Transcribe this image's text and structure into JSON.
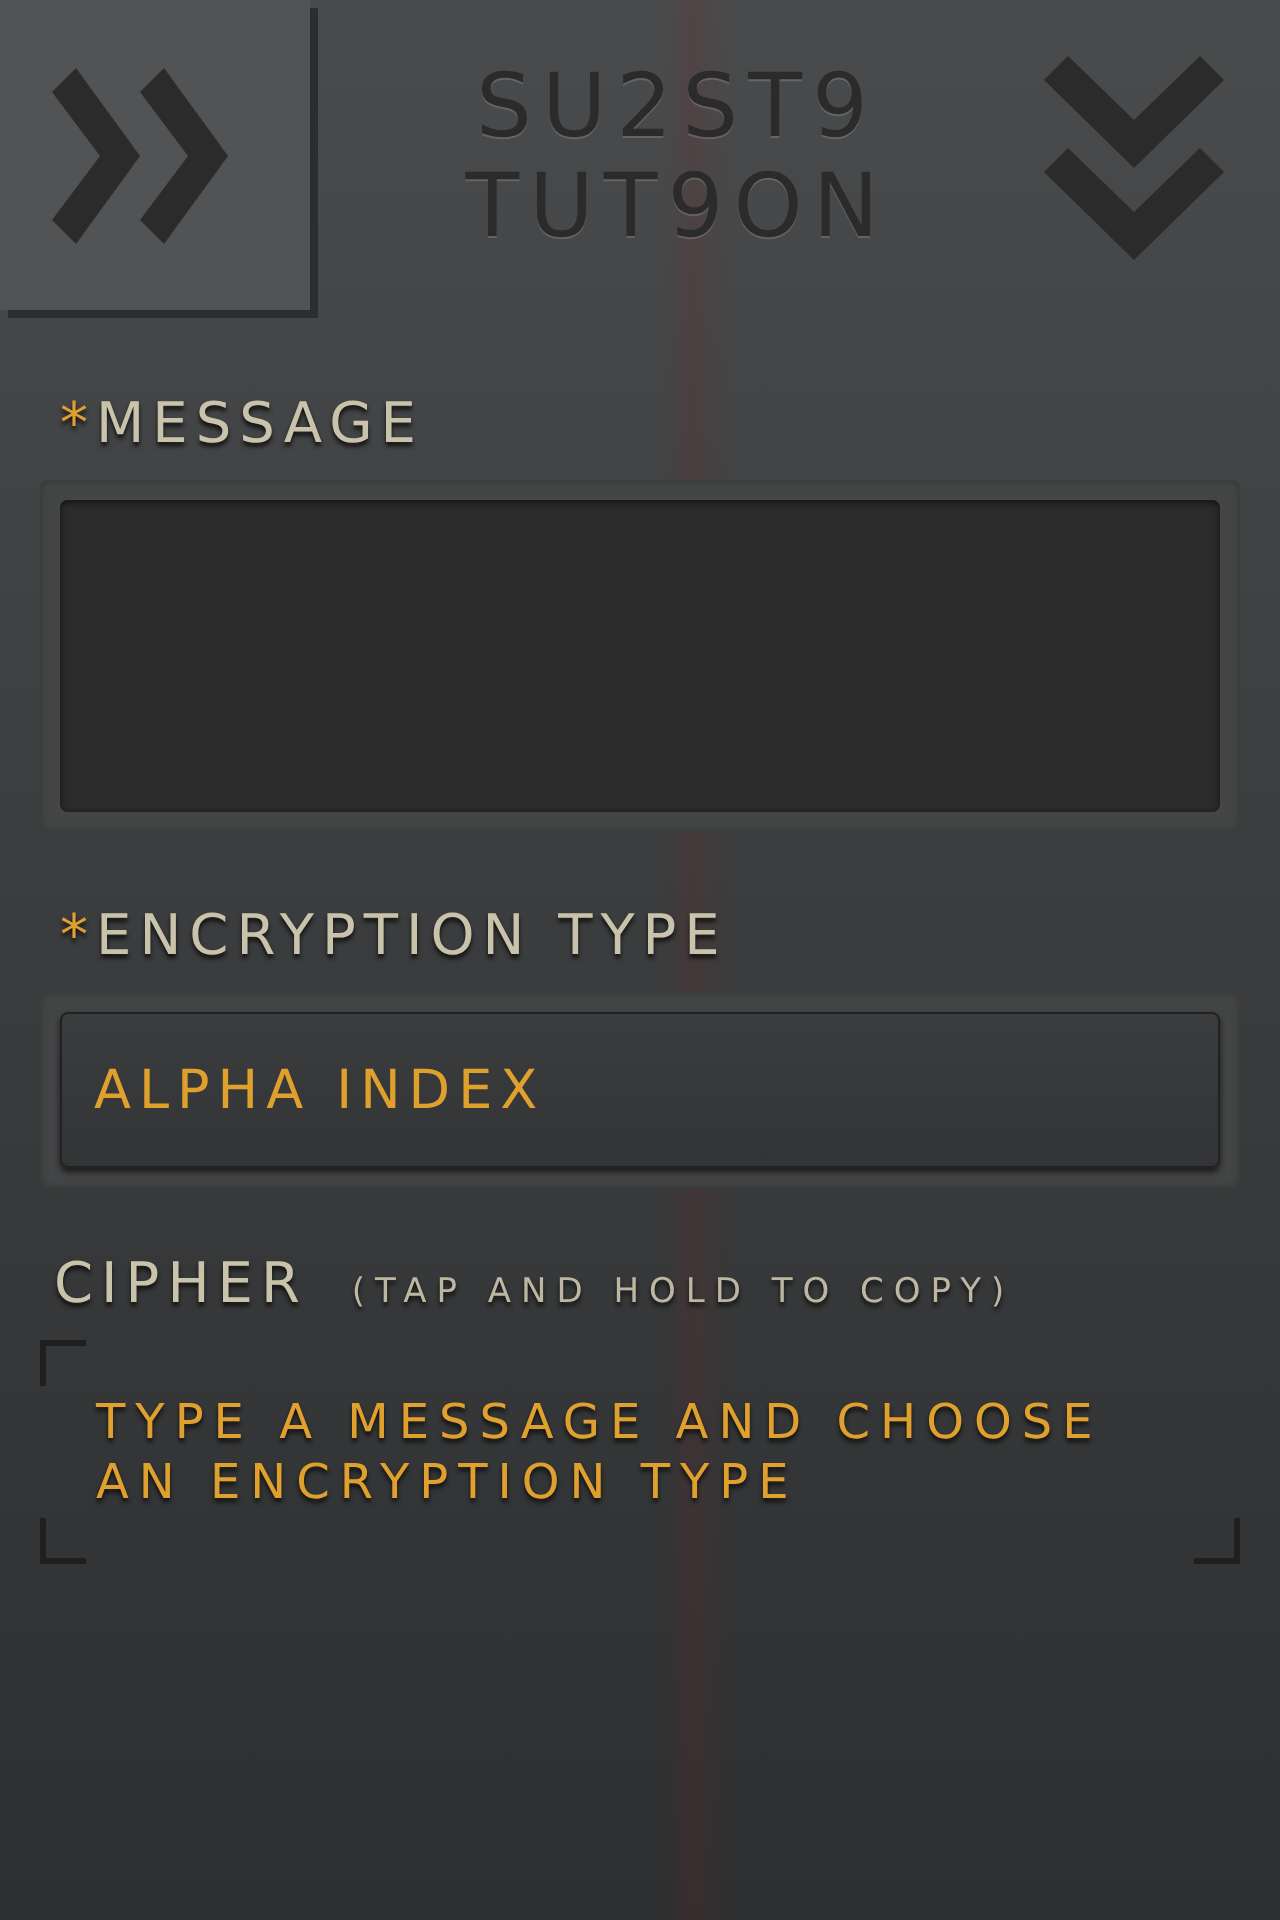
{
  "header": {
    "title_lines": [
      "SU2ST9",
      "TUT9ON"
    ]
  },
  "message": {
    "marker": "*",
    "label": "MESSAGE"
  },
  "encryption": {
    "marker": "*",
    "label": "ENCRYPTION TYPE",
    "value": "ALPHA INDEX"
  },
  "cipher": {
    "label": "CIPHER",
    "hint": "(TAP AND HOLD TO COPY)",
    "output": "TYPE A MESSAGE AND CHOOSE AN ENCRYPTION TYPE"
  }
}
